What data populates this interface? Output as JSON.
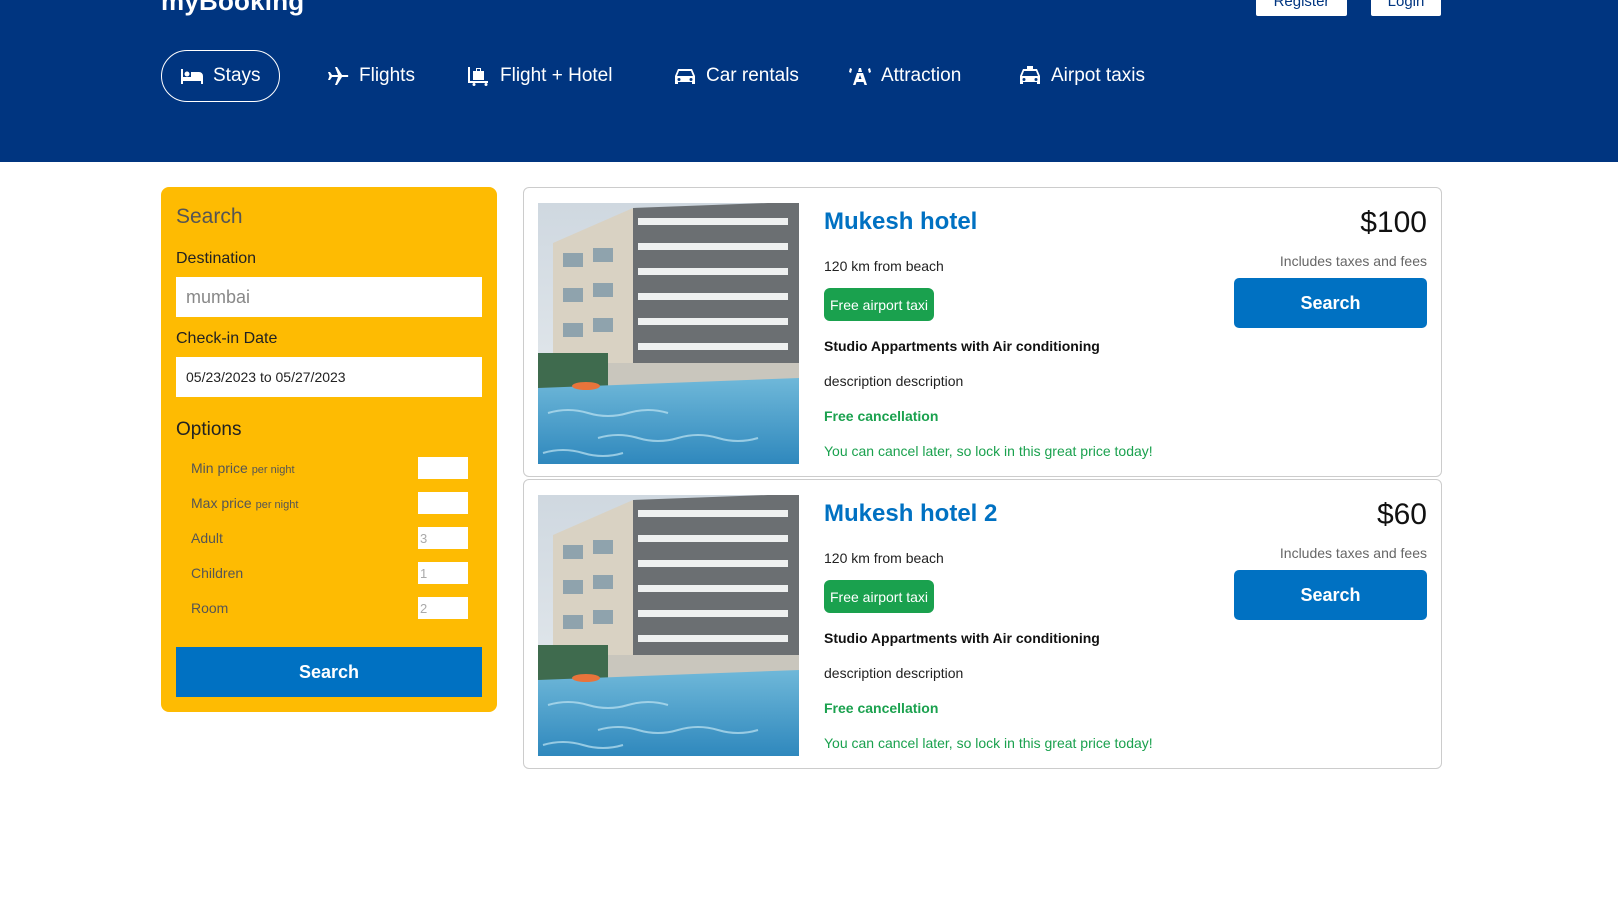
{
  "header": {
    "logo": "myBooking",
    "register_label": "Register",
    "login_label": "Login"
  },
  "nav": {
    "items": [
      {
        "label": "Stays",
        "icon": "bed-icon",
        "active": true
      },
      {
        "label": "Flights",
        "icon": "plane-icon"
      },
      {
        "label": "Flight + Hotel",
        "icon": "luggage-icon"
      },
      {
        "label": "Car rentals",
        "icon": "car-icon"
      },
      {
        "label": "Attraction",
        "icon": "tower-icon"
      },
      {
        "label": "Airpot taxis",
        "icon": "taxi-icon"
      }
    ]
  },
  "search": {
    "title": "Search",
    "destination_label": "Destination",
    "destination_placeholder": "mumbai",
    "checkin_label": "Check-in Date",
    "checkin_value": "05/23/2023 to 05/27/2023",
    "options_title": "Options",
    "options": [
      {
        "label": "Min price",
        "suffix": "per night",
        "value": ""
      },
      {
        "label": "Max price",
        "suffix": "per night",
        "value": ""
      },
      {
        "label": "Adult",
        "suffix": "",
        "value": "3"
      },
      {
        "label": "Children",
        "suffix": "",
        "value": "1"
      },
      {
        "label": "Room",
        "suffix": "",
        "value": "2"
      }
    ],
    "button_label": "Search"
  },
  "results": [
    {
      "name": "Mukesh hotel",
      "distance": "120 km from beach",
      "taxi": "Free airport taxi",
      "subtitle": "Studio Appartments with Air conditioning",
      "description": "description description",
      "cancel": "Free cancellation",
      "cancel_sub": "You can cancel later, so lock in this great price today!",
      "price": "$100",
      "taxes": "Includes taxes and fees",
      "button_label": "Search"
    },
    {
      "name": "Mukesh hotel 2",
      "distance": "120 km from beach",
      "taxi": "Free airport taxi",
      "subtitle": "Studio Appartments with Air conditioning",
      "description": "description description",
      "cancel": "Free cancellation",
      "cancel_sub": "You can cancel later, so lock in this great price today!",
      "price": "$60",
      "taxes": "Includes taxes and fees",
      "button_label": "Search"
    }
  ],
  "colors": {
    "header": "#003580",
    "sidebar": "#febb02",
    "primary": "#0071c2",
    "green": "#1aa14e"
  }
}
